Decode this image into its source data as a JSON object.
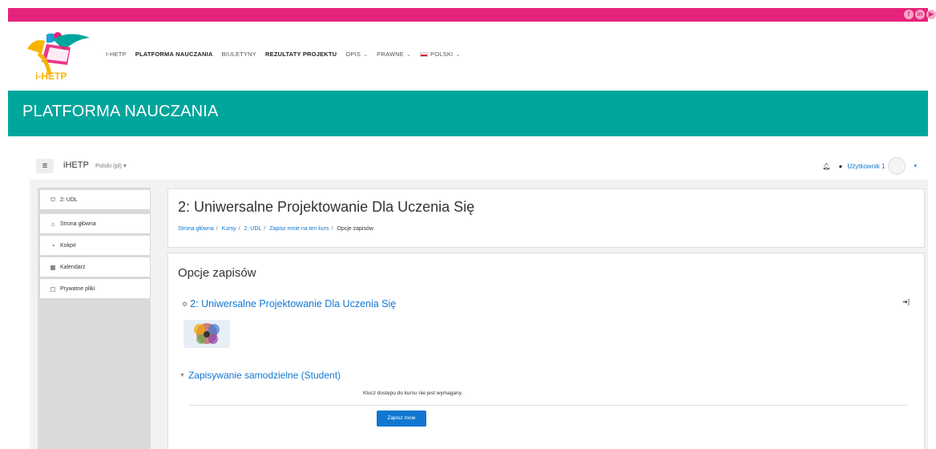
{
  "social": [
    {
      "icon": "facebook-icon",
      "glyph": "f"
    },
    {
      "icon": "linkedin-icon",
      "glyph": "in"
    },
    {
      "icon": "youtube-icon",
      "glyph": "▶"
    }
  ],
  "logo": {
    "text": "i-HETP"
  },
  "main_nav": [
    {
      "label": "I-HETP",
      "bold": false,
      "dropdown": false
    },
    {
      "label": "PLATFORMA NAUCZANIA",
      "bold": true,
      "dropdown": false
    },
    {
      "label": "BIULETYNY",
      "bold": false,
      "dropdown": false
    },
    {
      "label": "REZULTATY PROJEKTU",
      "bold": true,
      "dropdown": false
    },
    {
      "label": "OPIS",
      "bold": false,
      "dropdown": true
    },
    {
      "label": "PRAWNE",
      "bold": false,
      "dropdown": true
    },
    {
      "label": "POLSKI",
      "bold": false,
      "dropdown": true,
      "flag": true
    }
  ],
  "banner": {
    "title": "PLATFORMA NAUCZANIA"
  },
  "moodle_nav": {
    "brand": "iHETP",
    "language": "Polski (pl)",
    "user": "Użytkownik 1"
  },
  "sidebar": {
    "items": [
      {
        "icon": "graduation-cap-icon",
        "glyph": "🎓",
        "label": "2: UDL"
      },
      {
        "icon": "home-icon",
        "glyph": "⌂",
        "label": "Strona główna"
      },
      {
        "icon": "dashboard-icon",
        "glyph": "◔",
        "label": "Kokpit"
      },
      {
        "icon": "calendar-icon",
        "glyph": "▦",
        "label": "Kalendarz"
      },
      {
        "icon": "file-icon",
        "glyph": "▢",
        "label": "Prywatne pliki"
      }
    ]
  },
  "header": {
    "title": "2: Uniwersalne Projektowanie Dla Uczenia Się",
    "breadcrumbs": [
      "Strona główna",
      "Kursy",
      "2: UDL",
      "Zapisz mnie na ten kurs"
    ],
    "breadcrumb_current": "Opcje zapisów"
  },
  "main": {
    "heading": "Opcje zapisów",
    "course_name": "2: Uniwersalne Projektowanie Dla Uczenia Się",
    "section_title": "Zapisywanie samodzielne (Student)",
    "key_text": "Klucz dostępu do kursu nie jest wymagany.",
    "enrol_button": "Zapisz mnie"
  },
  "colors": {
    "top_bar": "#e6237a",
    "banner": "#00a59c",
    "link": "#1177d1",
    "button": "#1177d1"
  }
}
